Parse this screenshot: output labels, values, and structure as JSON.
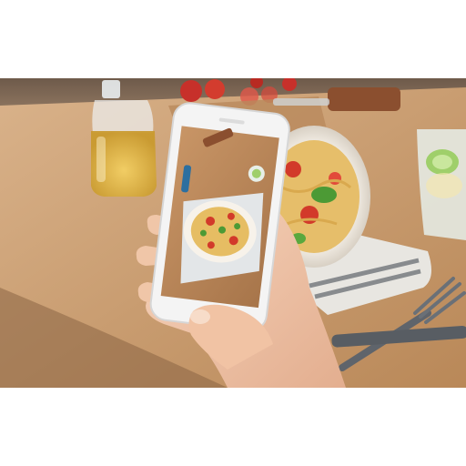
{
  "image": {
    "subject": "hand-holding-smartphone-photographing-pasta",
    "colors": {
      "background": "#ffffff",
      "table": "#c89a6a",
      "table_dark": "#9c7048",
      "phone_body": "#f4f4f4",
      "plate": "#f6f1e8",
      "pasta": "#e8c26a",
      "tomato": "#d23a2a",
      "basil": "#4c9a35",
      "napkin": "#e6e4df",
      "oil": "#e2b546",
      "glass": "#e4eee8",
      "skin": "#f2c9ae",
      "fork": "#5f646b"
    }
  }
}
